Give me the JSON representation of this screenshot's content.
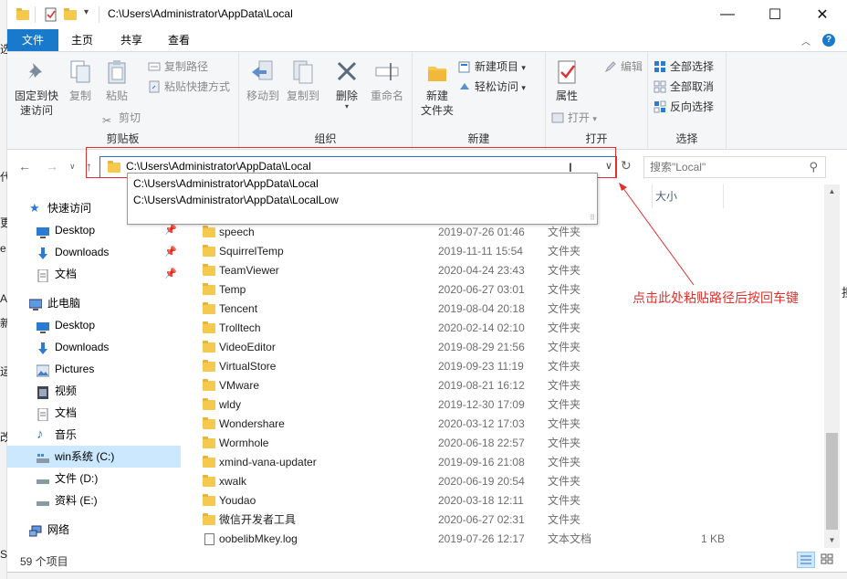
{
  "title": {
    "path": "C:\\Users\\Administrator\\AppData\\Local"
  },
  "window_buttons": {
    "minimize": "—",
    "maximize": "☐",
    "close": "✕"
  },
  "tabs": [
    {
      "label": "文件"
    },
    {
      "label": "主页"
    },
    {
      "label": "共享"
    },
    {
      "label": "查看"
    }
  ],
  "ribbon": {
    "clipboard": {
      "pin": "固定到快\n速访问",
      "pin_l1": "固定到快",
      "pin_l2": "速访问",
      "copy": "复制",
      "paste": "粘贴",
      "copy_path": "复制路径",
      "paste_shortcut": "粘贴快捷方式",
      "cut": "剪切",
      "group": "剪贴板"
    },
    "organize": {
      "move_to": "移动到",
      "copy_to": "复制到",
      "delete": "删除",
      "rename": "重命名",
      "group": "组织"
    },
    "new": {
      "new_folder_l1": "新建",
      "new_folder_l2": "文件夹",
      "new_item": "新建项目",
      "easy_access": "轻松访问",
      "group": "新建"
    },
    "open": {
      "properties": "属性",
      "open": "打开",
      "edit": "编辑",
      "group": "打开"
    },
    "select": {
      "select_all": "全部选择",
      "select_none": "全部取消",
      "invert": "反向选择",
      "group": "选择"
    }
  },
  "address": {
    "value": "C:\\Users\\Administrator\\AppData\\Local",
    "suggestions": [
      "C:\\Users\\Administrator\\AppData\\Local",
      "C:\\Users\\Administrator\\AppData\\LocalLow"
    ]
  },
  "search": {
    "placeholder": "搜索\"Local\""
  },
  "nav": {
    "quick_access": "快速访问",
    "desktop": "Desktop",
    "downloads": "Downloads",
    "documents": "文档",
    "this_pc": "此电脑",
    "pc_desktop": "Desktop",
    "pc_downloads": "Downloads",
    "pictures": "Pictures",
    "videos": "视频",
    "pc_documents": "文档",
    "music": "音乐",
    "drive_c": "win系统 (C:)",
    "drive_d": "文件 (D:)",
    "drive_e": "资料 (E:)",
    "network": "网络"
  },
  "columns": {
    "size": "大小"
  },
  "files": [
    {
      "name": "speech",
      "date": "2019-07-26 01:46",
      "type": "文件夹",
      "size": ""
    },
    {
      "name": "SquirrelTemp",
      "date": "2019-11-11 15:54",
      "type": "文件夹",
      "size": ""
    },
    {
      "name": "TeamViewer",
      "date": "2020-04-24 23:43",
      "type": "文件夹",
      "size": ""
    },
    {
      "name": "Temp",
      "date": "2020-06-27 03:01",
      "type": "文件夹",
      "size": ""
    },
    {
      "name": "Tencent",
      "date": "2019-08-04 20:18",
      "type": "文件夹",
      "size": ""
    },
    {
      "name": "Trolltech",
      "date": "2020-02-14 02:10",
      "type": "文件夹",
      "size": ""
    },
    {
      "name": "VideoEditor",
      "date": "2019-08-29 21:56",
      "type": "文件夹",
      "size": ""
    },
    {
      "name": "VirtualStore",
      "date": "2019-09-23 11:19",
      "type": "文件夹",
      "size": ""
    },
    {
      "name": "VMware",
      "date": "2019-08-21 16:12",
      "type": "文件夹",
      "size": ""
    },
    {
      "name": "wldy",
      "date": "2019-12-30 17:09",
      "type": "文件夹",
      "size": ""
    },
    {
      "name": "Wondershare",
      "date": "2020-03-12 17:03",
      "type": "文件夹",
      "size": ""
    },
    {
      "name": "Wormhole",
      "date": "2020-06-18 22:57",
      "type": "文件夹",
      "size": ""
    },
    {
      "name": "xmind-vana-updater",
      "date": "2019-09-16 21:08",
      "type": "文件夹",
      "size": ""
    },
    {
      "name": "xwalk",
      "date": "2020-06-19 20:54",
      "type": "文件夹",
      "size": ""
    },
    {
      "name": "Youdao",
      "date": "2020-03-18 12:11",
      "type": "文件夹",
      "size": ""
    },
    {
      "name": "微信开发者工具",
      "date": "2020-06-27 02:31",
      "type": "文件夹",
      "size": ""
    },
    {
      "name": "oobelibMkey.log",
      "date": "2019-07-26 12:17",
      "type": "文本文档",
      "size": "1 KB"
    }
  ],
  "status": {
    "count": "59 个项目"
  },
  "annotation": {
    "text": "点击此处粘贴路径后按回车键",
    "color": "#e0302c"
  },
  "colors": {
    "accent": "#1979ca",
    "folder": "#f5c94d",
    "selection": "#cce8ff"
  }
}
